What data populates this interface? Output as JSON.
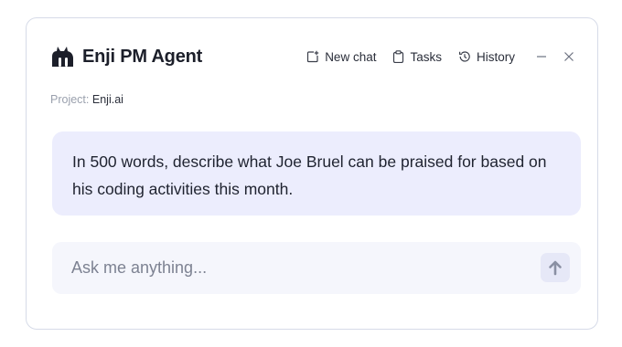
{
  "header": {
    "title": "Enji PM Agent",
    "logo_icon": "enji-logo-icon",
    "actions": {
      "new_chat": "New chat",
      "tasks": "Tasks",
      "history": "History"
    }
  },
  "project": {
    "label": "Project:",
    "value": "Enji.ai"
  },
  "conversation": {
    "user_message": "In 500 words, describe what Joe Bruel can be praised for based on his coding activities this month."
  },
  "composer": {
    "placeholder": "Ask me anything..."
  },
  "colors": {
    "bubble_bg": "#ecedfd",
    "composer_bg": "#f5f6fc",
    "border": "#d6dbe8",
    "send_button_bg": "#e6e8f7"
  }
}
